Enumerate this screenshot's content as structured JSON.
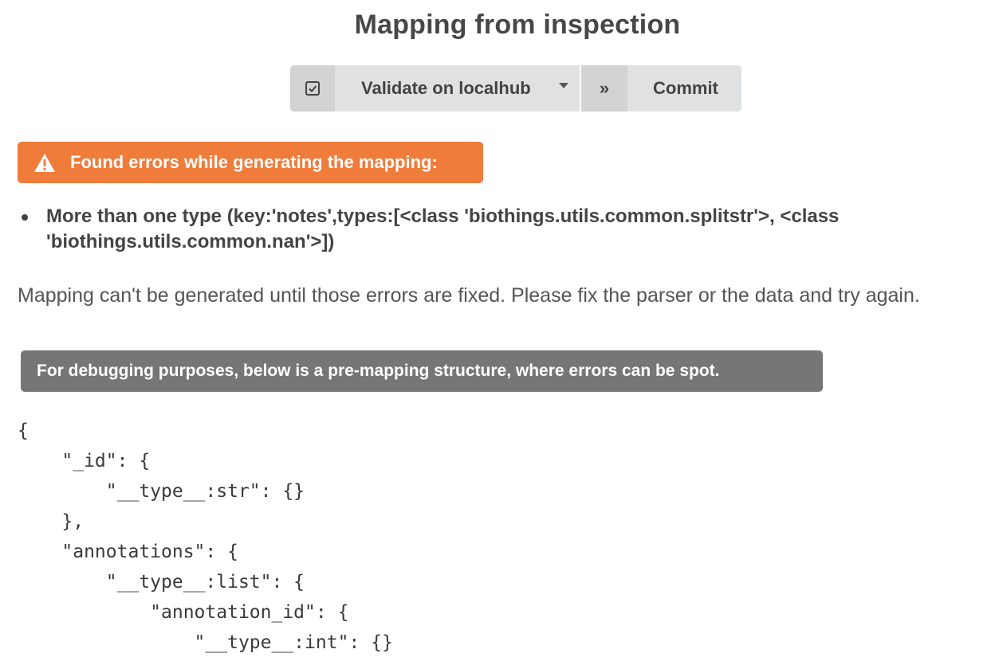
{
  "header": {
    "title": "Mapping from inspection"
  },
  "toolbar": {
    "validate_icon": "checkbox-check-icon",
    "validate_label": "Validate on localhub",
    "dropdown_icon": "caret-down-icon",
    "commit_icon": "double-chevron-right-icon",
    "commit_icon_glyph": "»",
    "commit_label": "Commit"
  },
  "errors": {
    "header_icon": "warning-triangle-icon",
    "header_label": "Found errors while generating the mapping:",
    "items": [
      "More than one type (key:'notes',types:[<class 'biothings.utils.common.splitstr'>, <class 'biothings.utils.common.nan'>])"
    ]
  },
  "message": "Mapping can't be generated until those errors are fixed. Please fix the parser or the data and try again.",
  "debug": {
    "label": "For debugging purposes, below is a pre-mapping structure, where errors can be spot.",
    "code": "{\n    \"_id\": {\n        \"__type__:str\": {}\n    },\n    \"annotations\": {\n        \"__type__:list\": {\n            \"annotation_id\": {\n                \"__type__:int\": {}"
  },
  "colors": {
    "error_orange": "#ef7c3b",
    "debug_grey": "#767676",
    "button_grey": "#e0e1e2"
  }
}
